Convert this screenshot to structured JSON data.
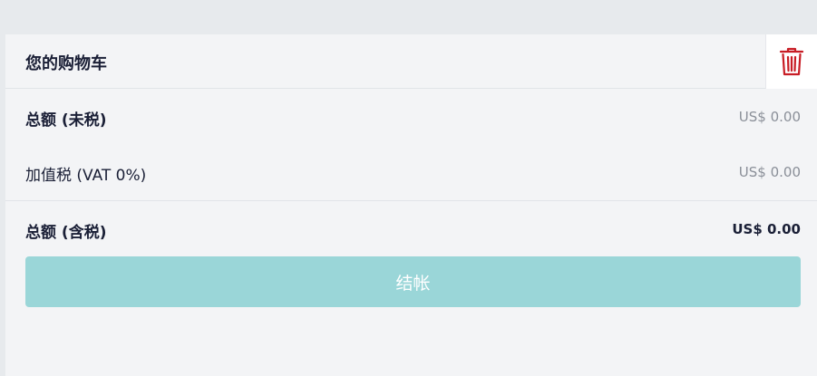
{
  "cart": {
    "title": "您的购物车",
    "delete_icon": "trash-icon",
    "subtotal_label": "总额 (未税)",
    "subtotal_value": "US$ 0.00",
    "vat_label": "加值税 (VAT 0%)",
    "vat_value": "US$ 0.00",
    "total_label": "总额 (含税)",
    "total_value": "US$ 0.00",
    "checkout_label": "结帐"
  },
  "colors": {
    "trash": "#c81d25",
    "checkout_bg": "#9ad6d8",
    "text_dark": "#1a1f36",
    "text_muted": "#8a8f98"
  }
}
